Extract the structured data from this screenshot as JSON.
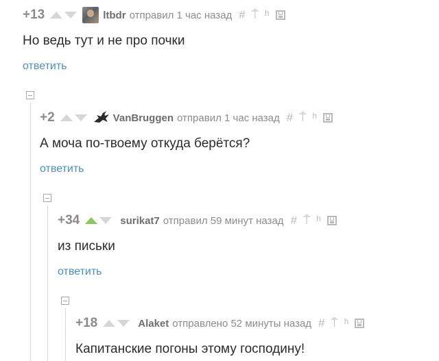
{
  "comments": [
    {
      "rating": "+13",
      "vote_up_active": false,
      "author": "ltbdr",
      "avatar": "photo-avatar",
      "meta": "отправил 1 час назад",
      "text": "Но ведь тут и не про почки",
      "reply_label": "ответить"
    },
    {
      "rating": "+2",
      "vote_up_active": false,
      "author": "VanBruggen",
      "avatar": "dragon-icon",
      "meta": "отправил 1 час назад",
      "text": "А моча по-твоему откуда берётся?",
      "reply_label": "ответить"
    },
    {
      "rating": "+34",
      "vote_up_active": true,
      "author": "surikat7",
      "avatar": "",
      "meta": "отправил 59 минут назад",
      "text": "из письки",
      "reply_label": "ответить"
    },
    {
      "rating": "+18",
      "vote_up_active": false,
      "author": "Alaket",
      "avatar": "",
      "meta": "отправлено 52 минуты назад",
      "text": "Капитанские погоны этому господину!",
      "reply_label": ""
    }
  ],
  "icons": {
    "link": "#",
    "parent": "⍑",
    "branch": "ʰ",
    "save": "save-icon"
  },
  "colors": {
    "reply_link": "#4a8fc4",
    "upvote_active": "#8ac858",
    "rating": "#8a8a8a"
  }
}
